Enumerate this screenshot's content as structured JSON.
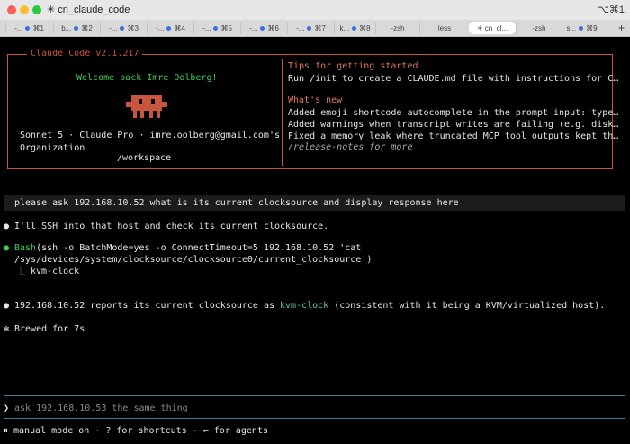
{
  "window": {
    "title": "✳ cn_claude_code",
    "shortcut": "⌥⌘1"
  },
  "tabs": [
    {
      "label": "-...",
      "key": "⌘1",
      "dot": true
    },
    {
      "label": "b...",
      "key": "⌘2",
      "dot": true
    },
    {
      "label": "-...",
      "key": "⌘3",
      "dot": true
    },
    {
      "label": "-...",
      "key": "⌘4",
      "dot": true
    },
    {
      "label": "-...",
      "key": "⌘5",
      "dot": true
    },
    {
      "label": "-...",
      "key": "⌘6",
      "dot": true
    },
    {
      "label": "-...",
      "key": "⌘7",
      "dot": true
    },
    {
      "label": "k...",
      "key": "⌘8",
      "dot": true
    },
    {
      "label": "-zsh",
      "key": "",
      "dot": false
    },
    {
      "label": "less",
      "key": "",
      "dot": false
    },
    {
      "label": "✳ cn_cl...",
      "key": "",
      "dot": false,
      "active": true
    },
    {
      "label": "-zsh",
      "key": "",
      "dot": false
    },
    {
      "label": "s...",
      "key": "⌘9",
      "dot": true
    }
  ],
  "tab_add": "+",
  "header": {
    "title": "Claude Code v2.1.217",
    "welcome": "Welcome back Imre Oolberg!",
    "account": "Sonnet 5 · Claude Pro · imre.oolberg@gmail.com's",
    "org": "Organization",
    "cwd": "/workspace",
    "tips_heading": "Tips for getting started",
    "tip": "Run /init to create a CLAUDE.md file with instructions for C…",
    "news_heading": "What's new",
    "news": [
      "Added emoji shortcode autocomplete in the prompt input: type…",
      "Added warnings when transcript writes are failing (e.g. disk…",
      "Fixed a memory leak where truncated MCP tool outputs kept th…"
    ],
    "release_notes": "/release-notes for more"
  },
  "user_message": "please ask 192.168.10.52 what is its current clocksource and display response here",
  "assistant_1": "I'll SSH into that host and check its current clocksource.",
  "tool": {
    "name": "Bash",
    "cmd_line1": "(ssh -o BatchMode=yes -o ConnectTimeout=5 192.168.10.52 'cat",
    "cmd_line2": "/sys/devices/system/clocksource/clocksource0/current_clocksource')",
    "output": "kvm-clock"
  },
  "assistant_2": {
    "pre": "192.168.10.52 reports its current clocksource as ",
    "highlight": "kvm-clock",
    "post": " (consistent with it being a KVM/virtualized host)."
  },
  "brewed": "Brewed for 7s",
  "input": {
    "prompt": "❯",
    "value": "ask 192.168.10.53 the same thing"
  },
  "status": "⏸ manual mode on · ? for shortcuts · ← for agents",
  "colors": {
    "accent": "#c8553d",
    "success": "#3ecb5a",
    "highlight": "#5fc8b4"
  }
}
